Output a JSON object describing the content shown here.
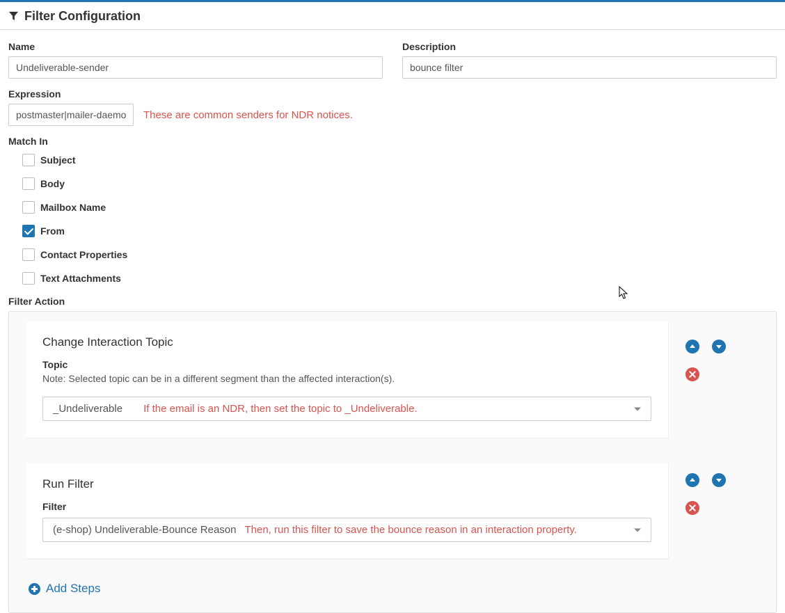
{
  "header": {
    "title": "Filter Configuration"
  },
  "form": {
    "name_label": "Name",
    "name_value": "Undeliverable-sender",
    "description_label": "Description",
    "description_value": "bounce filter",
    "expression_label": "Expression",
    "expression_value": "postmaster|mailer-daemon",
    "expression_annotation": "These are common senders for NDR notices."
  },
  "match_in": {
    "label": "Match In",
    "options": [
      {
        "label": "Subject",
        "checked": false
      },
      {
        "label": "Body",
        "checked": false
      },
      {
        "label": "Mailbox Name",
        "checked": false
      },
      {
        "label": "From",
        "checked": true
      },
      {
        "label": "Contact Properties",
        "checked": false
      },
      {
        "label": "Text Attachments",
        "checked": false
      }
    ]
  },
  "filter_action": {
    "label": "Filter Action",
    "actions": [
      {
        "title": "Change Interaction Topic",
        "field_label": "Topic",
        "note": "Note: Selected topic can be in a different segment than the affected interaction(s).",
        "selected": "_Undeliverable",
        "annotation": "If the email is an NDR, then set the topic to _Undeliverable."
      },
      {
        "title": "Run Filter",
        "field_label": "Filter",
        "selected": "(e-shop) Undeliverable-Bounce Reason",
        "annotation": "Then, run this filter to save the bounce reason in an interaction property."
      }
    ],
    "add_steps_label": "Add Steps"
  }
}
